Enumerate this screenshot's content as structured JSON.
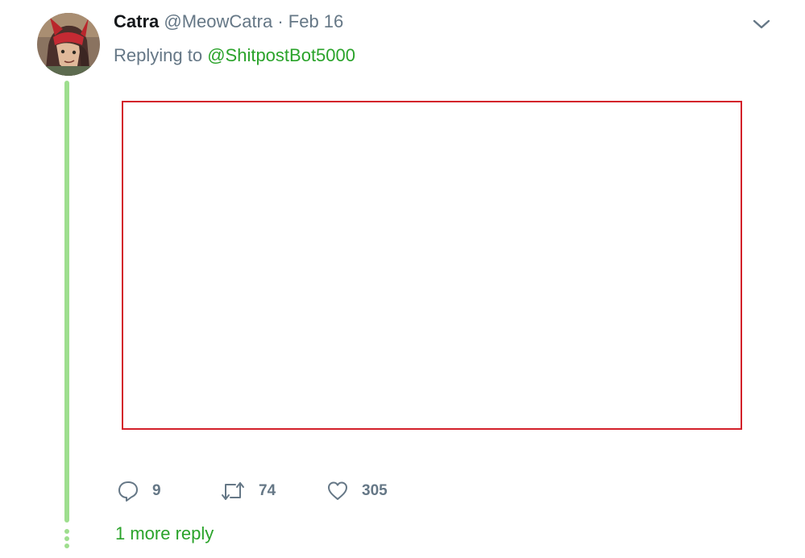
{
  "tweet": {
    "author_name": "Catra",
    "author_handle": "@MeowCatra",
    "separator": "·",
    "date": "Feb 16",
    "replying_prefix": "Replying to",
    "replying_to": "@ShitpostBot5000"
  },
  "actions": {
    "reply_count": "9",
    "retweet_count": "74",
    "like_count": "305"
  },
  "thread": {
    "more_replies": "1 more reply"
  },
  "icons": {
    "avatar": "avatar-image",
    "menu": "chevron-down-icon",
    "reply": "reply-bubble-icon",
    "retweet": "retweet-icon",
    "like": "heart-icon"
  },
  "colors": {
    "accent": "#2aa32a",
    "thread_line": "#9ede8e",
    "muted_text": "#657786",
    "name_text": "#14171a",
    "media_border": "#d3202a"
  }
}
